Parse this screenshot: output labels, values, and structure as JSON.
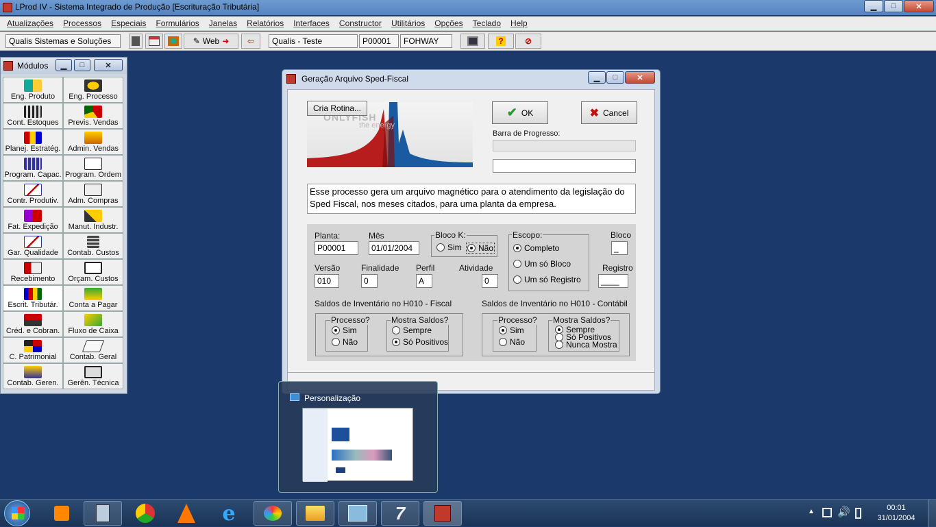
{
  "main_window": {
    "title": "LProd IV - Sistema Integrado de Produção [Escrituração Tributária]"
  },
  "menu": [
    "Atualizações",
    "Processos",
    "Especiais",
    "Formulários",
    "Janelas",
    "Relatórios",
    "Interfaces",
    "Constructor",
    "Utilitários",
    "Opções",
    "Teclado",
    "Help"
  ],
  "toolbar": {
    "company": "Qualis Sistemas e Soluções",
    "web_label": "Web",
    "env": "Qualis - Teste",
    "code": "P00001",
    "user": "FOHWAY"
  },
  "modules": {
    "title": "Módulos",
    "items": [
      "Eng. Produto",
      "Eng. Processo",
      "Cont. Estoques",
      "Previs. Vendas",
      "Planej. Estratég.",
      "Admin. Vendas",
      "Program. Capac.",
      "Program. Ordem",
      "Contr. Produtiv.",
      "Adm. Compras",
      "Fat. Expedição",
      "Manut. Industr.",
      "Gar. Qualidade",
      "Contab. Custos",
      "Recebimento",
      "Orçam. Custos",
      "Escrit. Tributár.",
      "Conta a Pagar",
      "Créd. e Cobran.",
      "Fluxo de Caixa",
      "C. Patrimonial",
      "Contab. Geral",
      "Contab. Geren.",
      "Gerên. Técnica"
    ]
  },
  "dialog": {
    "title": "Geração Arquivo Sped-Fiscal",
    "cria_rotina": "Cria Rotina...",
    "ok": "OK",
    "cancel": "Cancel",
    "progress_label": "Barra de Progresso:",
    "banner_text1": "ONLYFISH",
    "banner_text2": "the energy",
    "description": "Esse processo gera um arquivo magnético para o atendimento da legislação do Sped Fiscal, nos meses citados, para uma planta da empresa.",
    "planta_label": "Planta:",
    "planta": "P00001",
    "mes_label": "Mês",
    "mes": "01/01/2004",
    "bloco_k_label": "Bloco K:",
    "sim": "Sim",
    "nao": "Não",
    "escopo_label": "Escopo:",
    "completo": "Completo",
    "um_bloco": "Um só Bloco",
    "um_registro": "Um só Registro",
    "bloco_label": "Bloco",
    "bloco": "_",
    "registro_label": "Registro",
    "registro": "____",
    "versao_label": "Versão",
    "versao": "010",
    "finalidade_label": "Finalidade",
    "finalidade": "0",
    "perfil_label": "Perfil",
    "perfil": "A",
    "atividade_label": "Atividade",
    "atividade": "0",
    "fiscal_title": "Saldos de Inventário no H010 - Fiscal",
    "contabil_title": "Saldos de Inventário no H010 - Contábil",
    "processo_label": "Processo?",
    "mostra_label": "Mostra Saldos?",
    "sempre": "Sempre",
    "so_positivos": "Só Positivos",
    "nunca_mostra": "Nunca Mostra"
  },
  "thumbnail": {
    "title": "Personalização"
  },
  "clock": {
    "time": "00:01",
    "date": "31/01/2004"
  }
}
